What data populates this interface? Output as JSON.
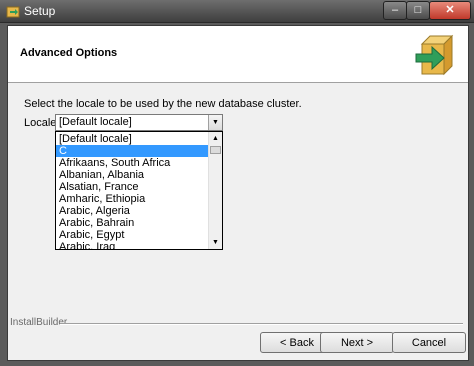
{
  "window": {
    "title": "Setup",
    "min_glyph": "–",
    "max_glyph": "□",
    "close_glyph": "✕"
  },
  "header": {
    "title": "Advanced Options",
    "icon": "installer-box-arrow-icon"
  },
  "body": {
    "prompt": "Select the locale to be used by the new database cluster.",
    "locale_label": "Locale",
    "locale_value": "[Default locale]",
    "locale_options": [
      "[Default locale]",
      "C",
      "Afrikaans, South Africa",
      "Albanian, Albania",
      "Alsatian, France",
      "Amharic, Ethiopia",
      "Arabic, Algeria",
      "Arabic, Bahrain",
      "Arabic, Egypt",
      "Arabic, Iraq"
    ],
    "selected_option": "C"
  },
  "footer": {
    "brand": "InstallBuilder",
    "back_label": "< Back",
    "next_label": "Next >",
    "cancel_label": "Cancel"
  },
  "colors": {
    "selection": "#3399ff",
    "close_button": "#c0392b",
    "box_icon": "#e8b84a",
    "arrow": "#2f9e5a"
  }
}
